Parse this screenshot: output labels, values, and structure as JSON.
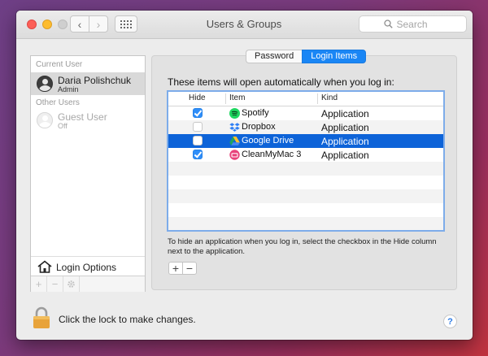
{
  "window": {
    "title": "Users & Groups",
    "search_placeholder": "Search",
    "nav_back": "‹",
    "nav_forward": "›"
  },
  "sidebar": {
    "current_user_header": "Current User",
    "other_users_header": "Other Users",
    "users": [
      {
        "name": "Daria Polishchuk",
        "role": "Admin",
        "selected": true
      },
      {
        "name": "Guest User",
        "role": "Off",
        "selected": false
      }
    ],
    "login_options_label": "Login Options",
    "toolbar": {
      "add": "+",
      "remove": "−",
      "settings_icon": "gear-icon"
    }
  },
  "tabs": [
    {
      "label": "Password",
      "active": false
    },
    {
      "label": "Login Items",
      "active": true
    }
  ],
  "login_items": {
    "intro": "These items will open automatically when you log in:",
    "columns": {
      "hide": "Hide",
      "item": "Item",
      "kind": "Kind"
    },
    "rows": [
      {
        "name": "Spotify",
        "kind": "Application",
        "hide": true,
        "icon": "spotify-icon",
        "selected": false
      },
      {
        "name": "Dropbox",
        "kind": "Application",
        "hide": false,
        "icon": "dropbox-icon",
        "selected": false
      },
      {
        "name": "Google Drive",
        "kind": "Application",
        "hide": false,
        "icon": "google-drive-icon",
        "selected": true
      },
      {
        "name": "CleanMyMac 3",
        "kind": "Application",
        "hide": true,
        "icon": "cleanmymac-icon",
        "selected": false
      }
    ],
    "hint": "To hide an application when you log in, select the checkbox in the Hide column next to the application.",
    "add_label": "+",
    "remove_label": "−"
  },
  "footer": {
    "lock_text": "Click the lock to make changes.",
    "help_label": "?"
  },
  "colors": {
    "selection": "#0d63d8",
    "tab_active": "#1a86f5",
    "checkbox_checked": "#2f8ef9",
    "table_focus_border": "#7dacea"
  }
}
